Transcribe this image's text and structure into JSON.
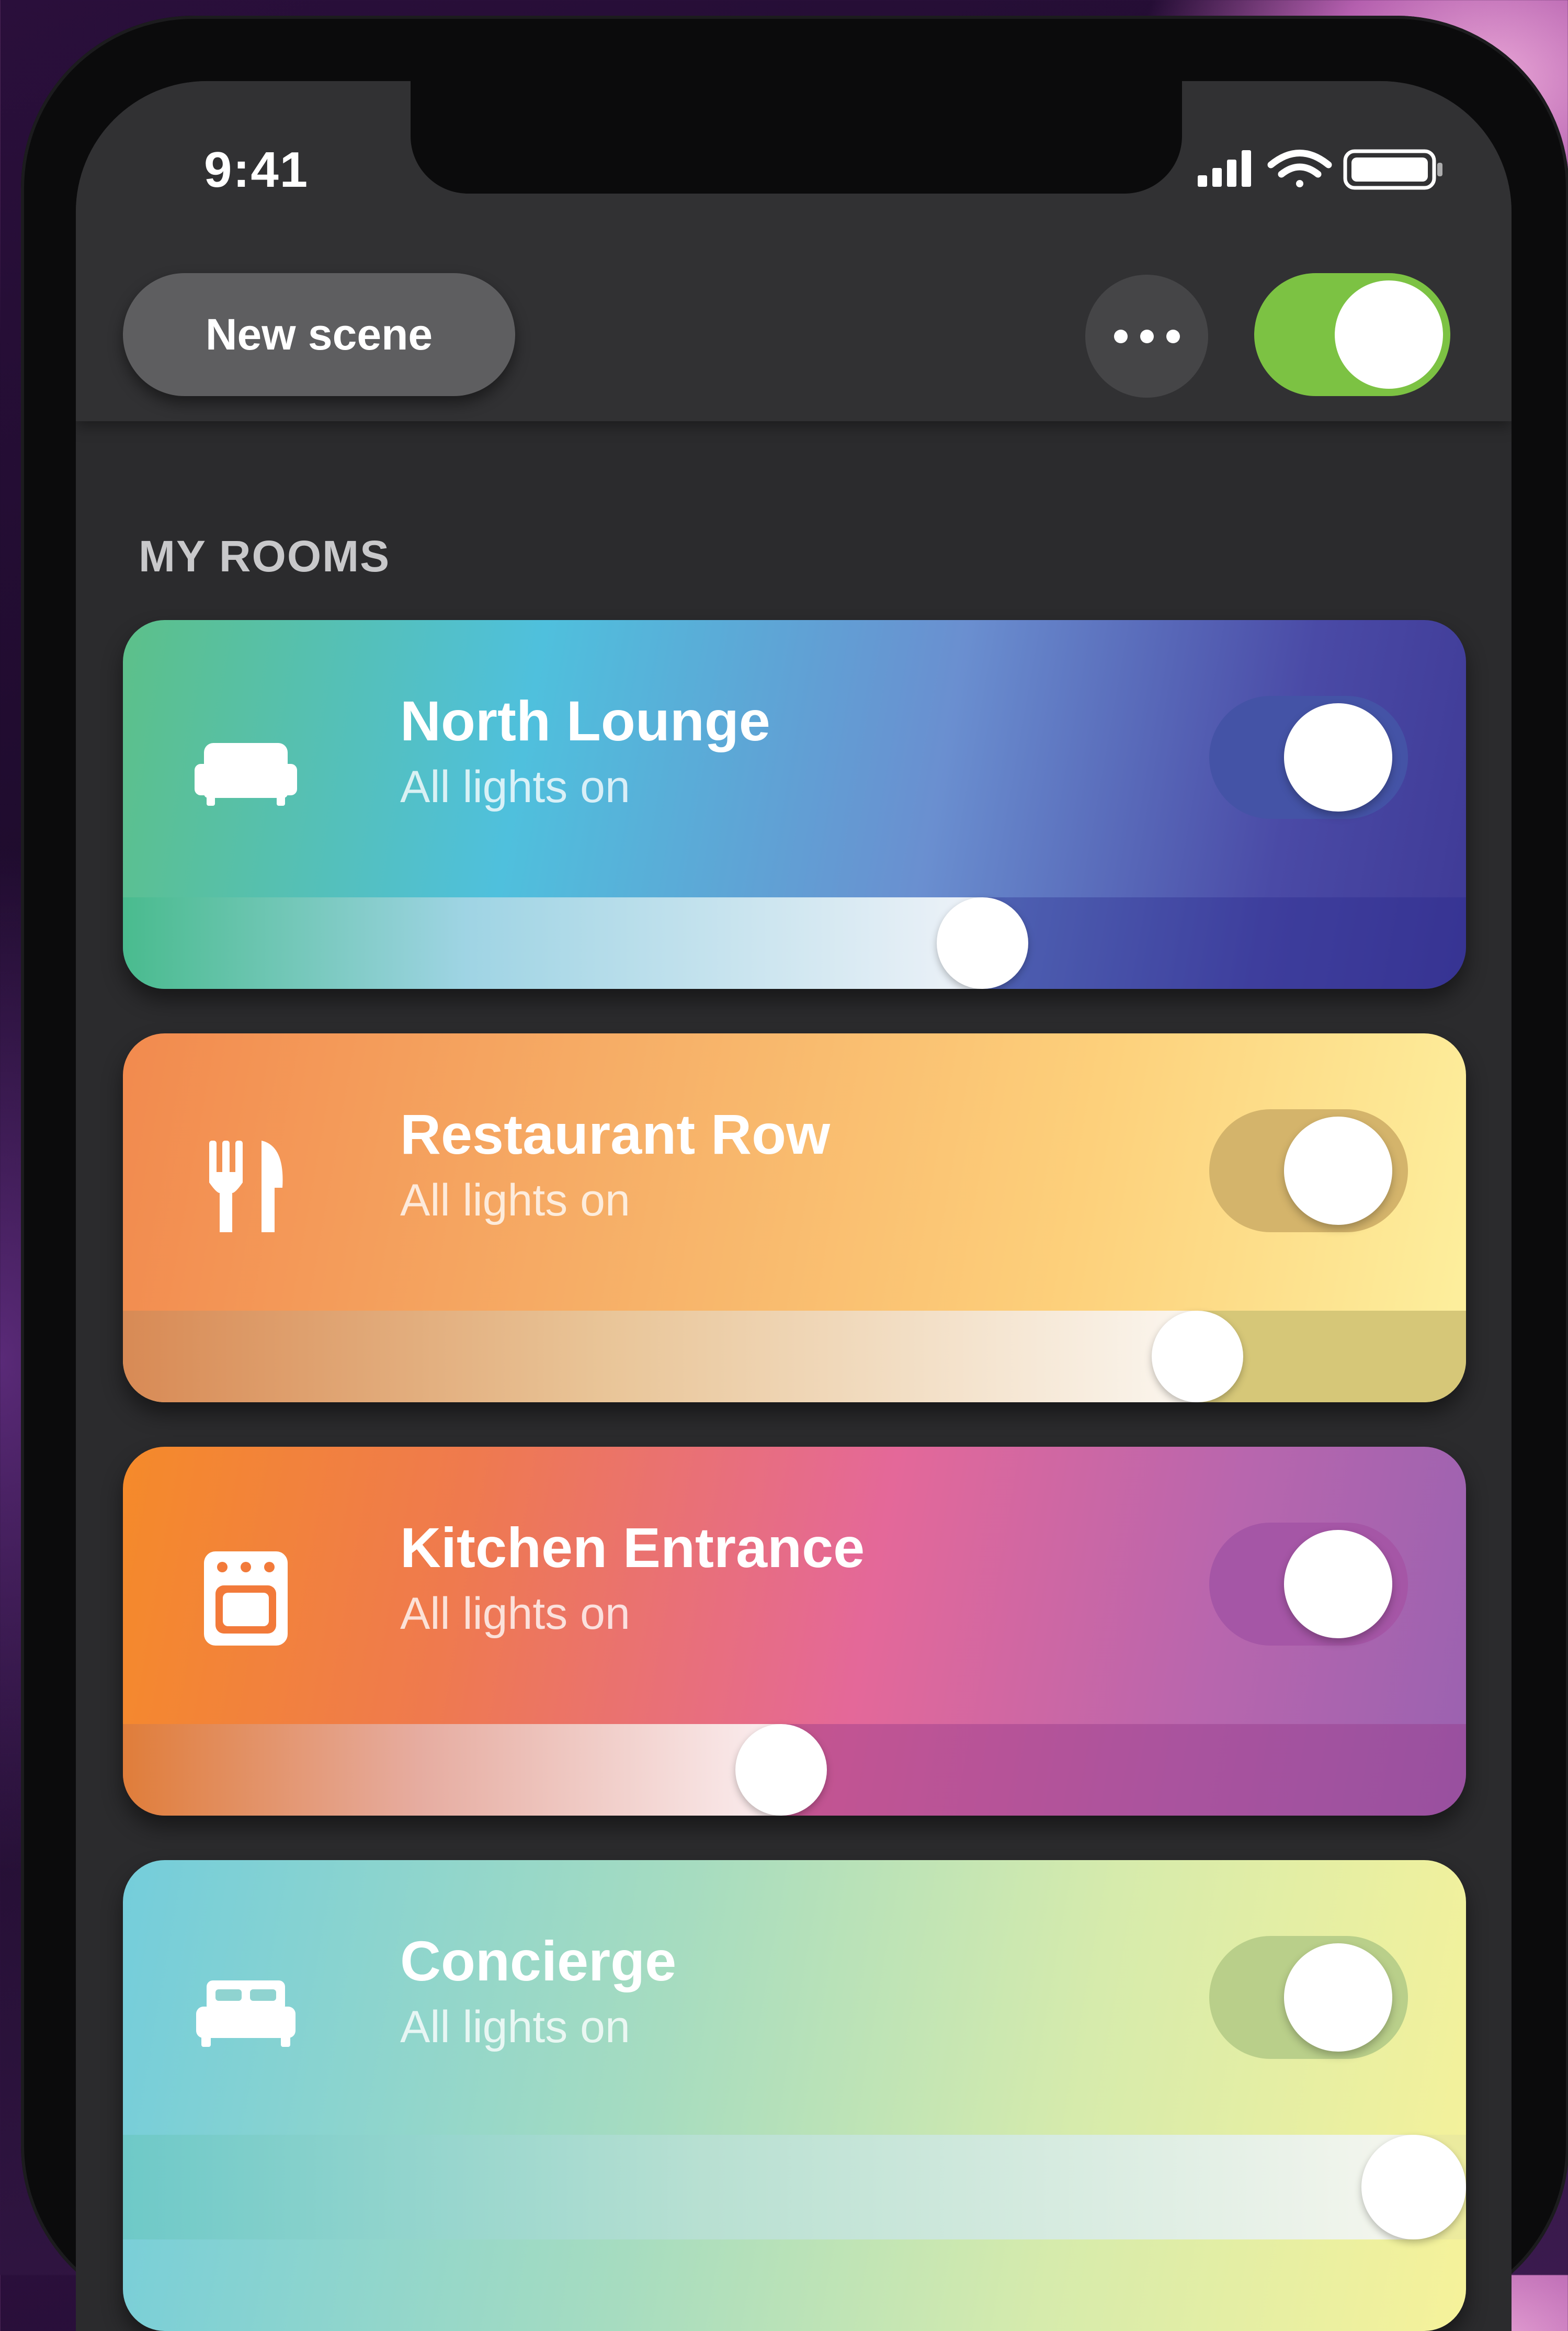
{
  "status_bar": {
    "time": "9:41"
  },
  "header": {
    "new_scene_label": "New scene",
    "master_toggle_on": true
  },
  "section": {
    "title": "MY ROOMS"
  },
  "colors": {
    "toggle_on": "#7cc243",
    "screen_bg": "#2b2b2d"
  },
  "rooms": [
    {
      "name": "North Lounge",
      "status": "All lights on",
      "icon": "sofa-icon",
      "on": true,
      "brightness": 0.64
    },
    {
      "name": "Restaurant Row",
      "status": "All lights on",
      "icon": "fork-knife-icon",
      "on": true,
      "brightness": 0.8
    },
    {
      "name": "Kitchen Entrance",
      "status": "All lights on",
      "icon": "oven-icon",
      "on": true,
      "brightness": 0.49
    },
    {
      "name": "Concierge",
      "status": "All lights on",
      "icon": "bed-icon",
      "on": true,
      "brightness": 0.97
    }
  ]
}
